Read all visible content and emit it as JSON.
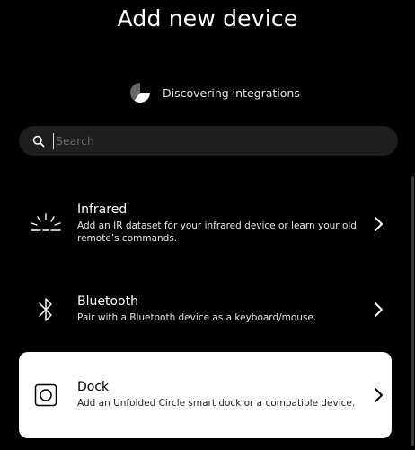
{
  "header": {
    "title": "Add new device"
  },
  "status": {
    "text": "Discovering integrations"
  },
  "search": {
    "placeholder": "Search",
    "value": ""
  },
  "items": [
    {
      "name": "Infrared",
      "description": "Add an IR dataset for your infrared device or learn your old remote’s commands.",
      "icon": "infrared-icon"
    },
    {
      "name": "Bluetooth",
      "description": "Pair with a Bluetooth device as a keyboard/mouse.",
      "icon": "bluetooth-icon"
    },
    {
      "name": "Dock",
      "description": "Add an Unfolded Circle smart dock or a compatible device.",
      "icon": "dock-icon",
      "selected": true
    }
  ],
  "colors": {
    "background": "#000000",
    "search_bg": "#1e1e1e",
    "selected_bg": "#ffffff"
  }
}
